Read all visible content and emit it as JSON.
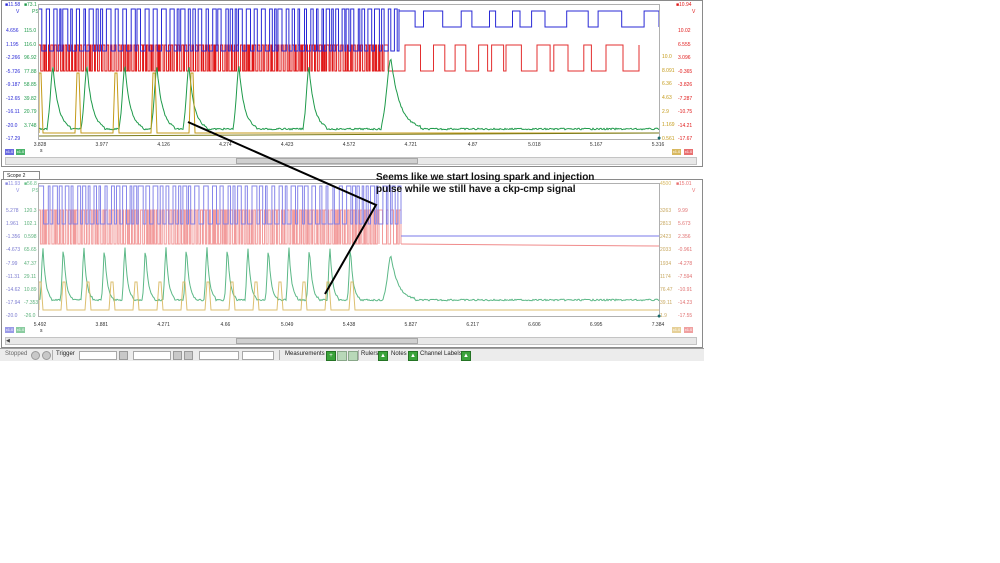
{
  "scope1": {
    "left_header": {
      "ch_a": "11.58",
      "ch_b": "73.1",
      "unit_a": "V",
      "unit_b": "PSI"
    },
    "right_header": {
      "top": "10.94",
      "unit": "V"
    },
    "left_scale_a": [
      "4.656",
      "1.195",
      "-2.266",
      "-5.726",
      "-9.187",
      "-12.65",
      "-16.11",
      "-20.0",
      "-17.29"
    ],
    "left_scale_b": [
      "115.0",
      "116.0",
      "96.92",
      "77.88",
      "58.85",
      "39.82",
      "20.79",
      "3.748"
    ],
    "right_scale_a": [
      "10.0",
      "8.091",
      "6.36",
      "4.63",
      "2.9",
      "1.169",
      "0.561"
    ],
    "right_scale_b": [
      "10.02",
      "6.555",
      "3.096",
      "-0.365",
      "-3.826",
      "-7.287",
      "-10.75",
      "-14.21",
      "-17.67"
    ],
    "x_ticks": [
      "3.828",
      "3.977",
      "4.126",
      "4.274",
      "4.423",
      "4.572",
      "4.721",
      "4.87",
      "5.018",
      "5.167",
      "5.316"
    ],
    "x_unit": "s",
    "chips_left": [
      "x1.0",
      "x1.0"
    ],
    "chips_right": [
      "x1.0",
      "x1.0"
    ]
  },
  "scope2": {
    "tab_label": "Scope 2",
    "left_header": {
      "ch_a": "11.93",
      "ch_b": "56.8",
      "unit_a": "V",
      "unit_b": "PSI"
    },
    "right_header": {
      "top": "4500",
      "top2": "15.01",
      "unit": "V"
    },
    "left_scale_a": [
      "5.278",
      "1.961",
      "-1.356",
      "-4.673",
      "-7.99",
      "-11.31",
      "-14.62",
      "-17.94",
      "-20.0"
    ],
    "left_scale_b": [
      "120.3",
      "102.1",
      "0.598",
      "65.65",
      "47.37",
      "29.11",
      "10.89",
      "-7.353",
      "-26.0"
    ],
    "right_scale_a": [
      "3263",
      "2813",
      "2423",
      "2033",
      "1934",
      "1174",
      "76.47",
      "39.11",
      "1.9"
    ],
    "right_scale_b": [
      "9.99",
      "5.673",
      "2.356",
      "-0.961",
      "-4.278",
      "-7.594",
      "-10.91",
      "-14.23",
      "-17.55"
    ],
    "x_ticks": [
      "5.492",
      "3.881",
      "4.271",
      "4.66",
      "5.049",
      "5.438",
      "5.827",
      "6.217",
      "6.606",
      "6.995",
      "7.384"
    ],
    "x_unit": "s",
    "chips_left": [
      "x1.0",
      "x1.0"
    ],
    "chips_right": [
      "x1.0",
      "x1.0"
    ]
  },
  "annotation": {
    "text": "Seems like we start losing spark and injection pulse while we still have a ckp-cmp signal"
  },
  "statusbar": {
    "state": "Stopped",
    "trigger": "Trigger",
    "measurements": "Measurements",
    "rulers": "Rulers",
    "notes": "Notes",
    "channel_labels": "Channel Labels"
  },
  "colors": {
    "blue": "#2a2ad6",
    "red": "#e01818",
    "green": "#1e9a4a",
    "gold": "#c49a18",
    "olive": "#7a7a18"
  }
}
